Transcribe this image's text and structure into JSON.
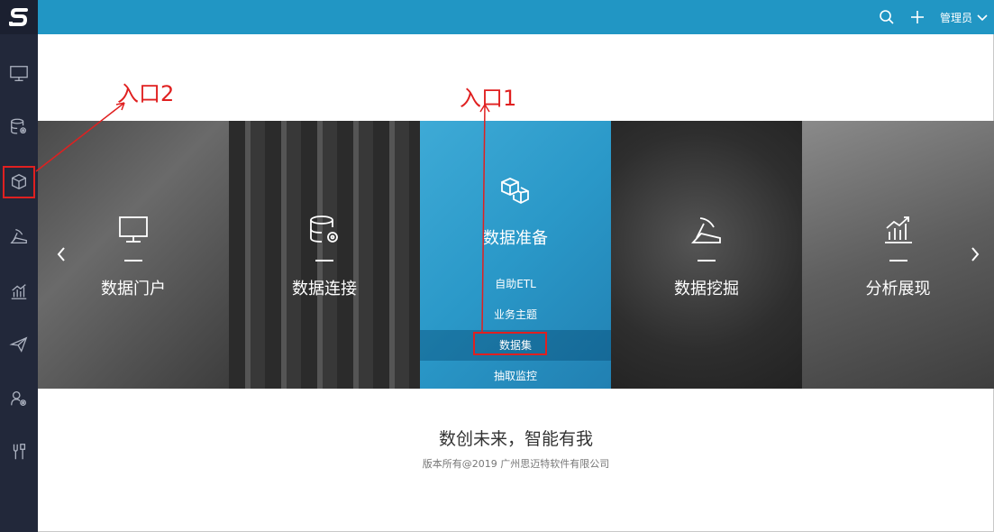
{
  "logo": "S",
  "sidebar": {
    "items": [
      {
        "icon": "monitor-icon"
      },
      {
        "icon": "database-gear-icon"
      },
      {
        "icon": "cube-icon",
        "active": true
      },
      {
        "icon": "mining-icon"
      },
      {
        "icon": "bar-chart-icon"
      },
      {
        "icon": "paper-plane-icon"
      },
      {
        "icon": "user-gear-icon"
      },
      {
        "icon": "tools-icon"
      }
    ]
  },
  "topbar": {
    "search_icon": "search-icon",
    "add_icon": "plus-icon",
    "user_label": "管理员"
  },
  "carousel": {
    "panels": [
      {
        "title": "数据门户",
        "icon": "monitor-icon"
      },
      {
        "title": "数据连接",
        "icon": "database-gear-icon"
      },
      {
        "title": "数据准备",
        "icon": "cubes-icon",
        "sub_items": [
          "自助ETL",
          "业务主题",
          "数据集",
          "抽取监控"
        ],
        "highlighted": "数据集"
      },
      {
        "title": "数据挖掘",
        "icon": "mining-icon"
      },
      {
        "title": "分析展现",
        "icon": "bar-chart-icon"
      }
    ]
  },
  "footer": {
    "slogan": "数创未来，智能有我",
    "copyright": "版本所有@2019 广州思迈特软件有限公司"
  },
  "annotations": {
    "entry1": "入口1",
    "entry2": "入口2",
    "color": "#e02020"
  }
}
